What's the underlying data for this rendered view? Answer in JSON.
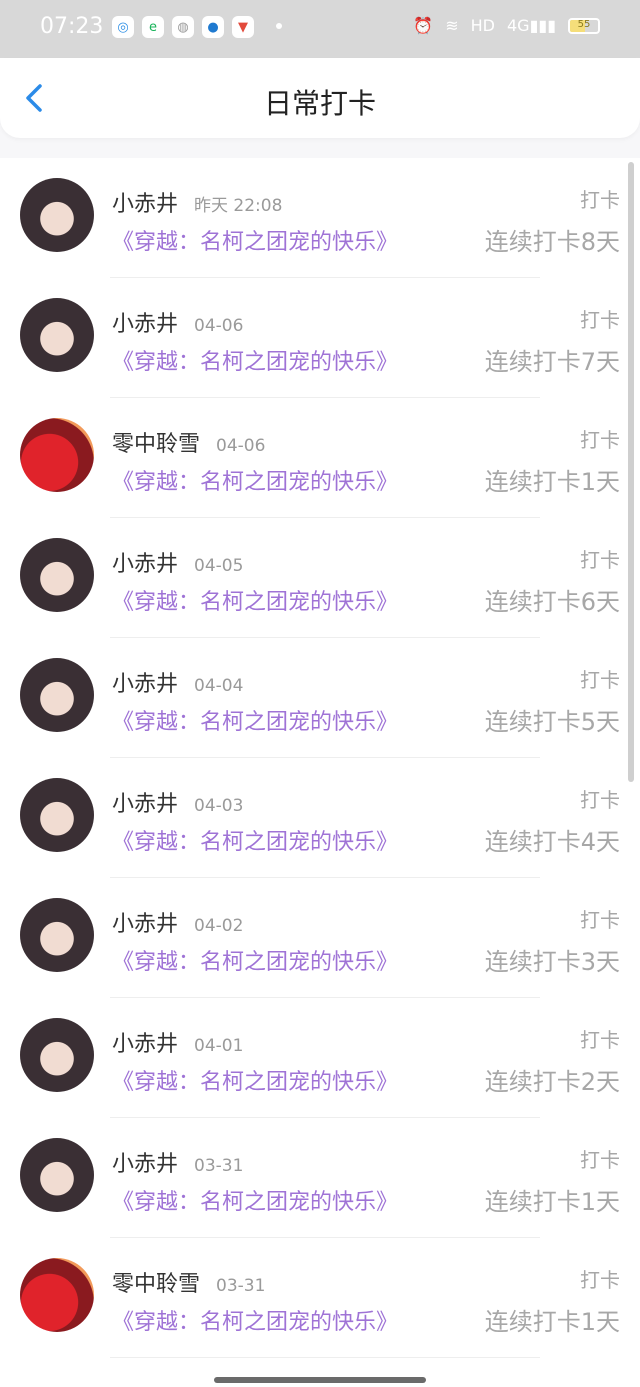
{
  "status": {
    "time": "07:23",
    "battery": "55",
    "hd": "HD",
    "network": "4G"
  },
  "header": {
    "title": "日常打卡"
  },
  "list": [
    {
      "name": "小赤井",
      "date": "昨天 22:08",
      "book": "《穿越：名柯之团宠的快乐》",
      "tag": "打卡",
      "streak": "连续打卡8天",
      "avatar": "anime"
    },
    {
      "name": "小赤井",
      "date": "04-06",
      "book": "《穿越：名柯之团宠的快乐》",
      "tag": "打卡",
      "streak": "连续打卡7天",
      "avatar": "anime"
    },
    {
      "name": "零中聆雪",
      "date": "04-06",
      "book": "《穿越：名柯之团宠的快乐》",
      "tag": "打卡",
      "streak": "连续打卡1天",
      "avatar": "flower"
    },
    {
      "name": "小赤井",
      "date": "04-05",
      "book": "《穿越：名柯之团宠的快乐》",
      "tag": "打卡",
      "streak": "连续打卡6天",
      "avatar": "anime"
    },
    {
      "name": "小赤井",
      "date": "04-04",
      "book": "《穿越：名柯之团宠的快乐》",
      "tag": "打卡",
      "streak": "连续打卡5天",
      "avatar": "anime"
    },
    {
      "name": "小赤井",
      "date": "04-03",
      "book": "《穿越：名柯之团宠的快乐》",
      "tag": "打卡",
      "streak": "连续打卡4天",
      "avatar": "anime"
    },
    {
      "name": "小赤井",
      "date": "04-02",
      "book": "《穿越：名柯之团宠的快乐》",
      "tag": "打卡",
      "streak": "连续打卡3天",
      "avatar": "anime"
    },
    {
      "name": "小赤井",
      "date": "04-01",
      "book": "《穿越：名柯之团宠的快乐》",
      "tag": "打卡",
      "streak": "连续打卡2天",
      "avatar": "anime"
    },
    {
      "name": "小赤井",
      "date": "03-31",
      "book": "《穿越：名柯之团宠的快乐》",
      "tag": "打卡",
      "streak": "连续打卡1天",
      "avatar": "anime"
    },
    {
      "name": "零中聆雪",
      "date": "03-31",
      "book": "《穿越：名柯之团宠的快乐》",
      "tag": "打卡",
      "streak": "连续打卡1天",
      "avatar": "flower"
    }
  ]
}
